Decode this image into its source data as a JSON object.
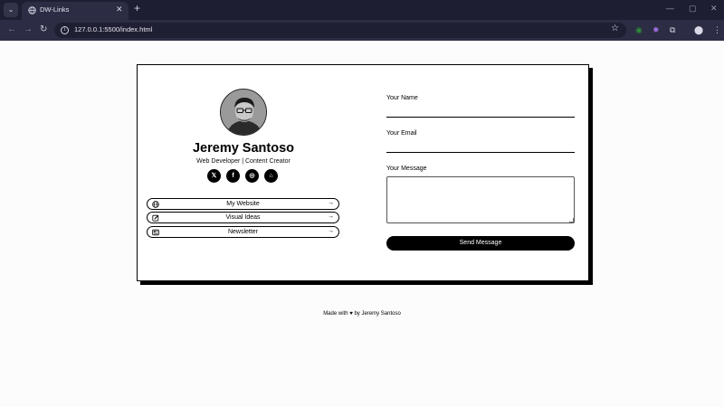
{
  "browser": {
    "tab_title": "DW-Links",
    "tab_menu_glyph": "⌄",
    "tab_close_glyph": "✕",
    "new_tab_glyph": "+",
    "url": "127.0.0.1:5500/index.html",
    "window_controls": [
      "—",
      "▢",
      "✕"
    ],
    "nav_glyphs": {
      "back": "←",
      "forward": "→",
      "reload": "↻"
    },
    "star_glyph": "☆",
    "extensions": [
      {
        "name": "green-extension-icon",
        "glyph": "◉",
        "color": "#2e8b3a"
      },
      {
        "name": "purple-extension-icon",
        "glyph": "✹",
        "color": "#9b6bd6"
      },
      {
        "name": "puzzle-icon",
        "glyph": "⧉",
        "color": "#d8d8e6"
      },
      {
        "name": "profile-icon",
        "glyph": "⬤",
        "color": "#d8d8e6"
      },
      {
        "name": "kebab-menu-icon",
        "glyph": "⋮",
        "color": "#d8d8e6"
      }
    ]
  },
  "profile": {
    "name": "Jeremy Santoso",
    "role": "Web Developer | Content Creator",
    "socials": [
      {
        "name": "x-icon",
        "glyph": "𝕏"
      },
      {
        "name": "facebook-icon",
        "glyph": "f"
      },
      {
        "name": "instagram-icon",
        "glyph": "◎"
      },
      {
        "name": "github-icon",
        "glyph": "⌂"
      }
    ]
  },
  "links": [
    {
      "label": "My Website",
      "icon": "globe-icon",
      "arrow": "→"
    },
    {
      "label": "Visual Ideas",
      "icon": "pencil-square-icon",
      "arrow": "→"
    },
    {
      "label": "Newsletter",
      "icon": "newspaper-icon",
      "arrow": "→"
    }
  ],
  "form": {
    "name_label": "Your Name",
    "email_label": "Your Email",
    "message_label": "Your Message",
    "send_label": "Send Message"
  },
  "footer": {
    "prefix": "Made with",
    "heart": "♥",
    "suffix": "by Jeremy Santoso"
  },
  "colors": {
    "chrome_dark": "#1e1e33",
    "chrome_toolbar": "#2c2c44",
    "page_bg": "#fdfcfd",
    "accent": "#000000"
  }
}
